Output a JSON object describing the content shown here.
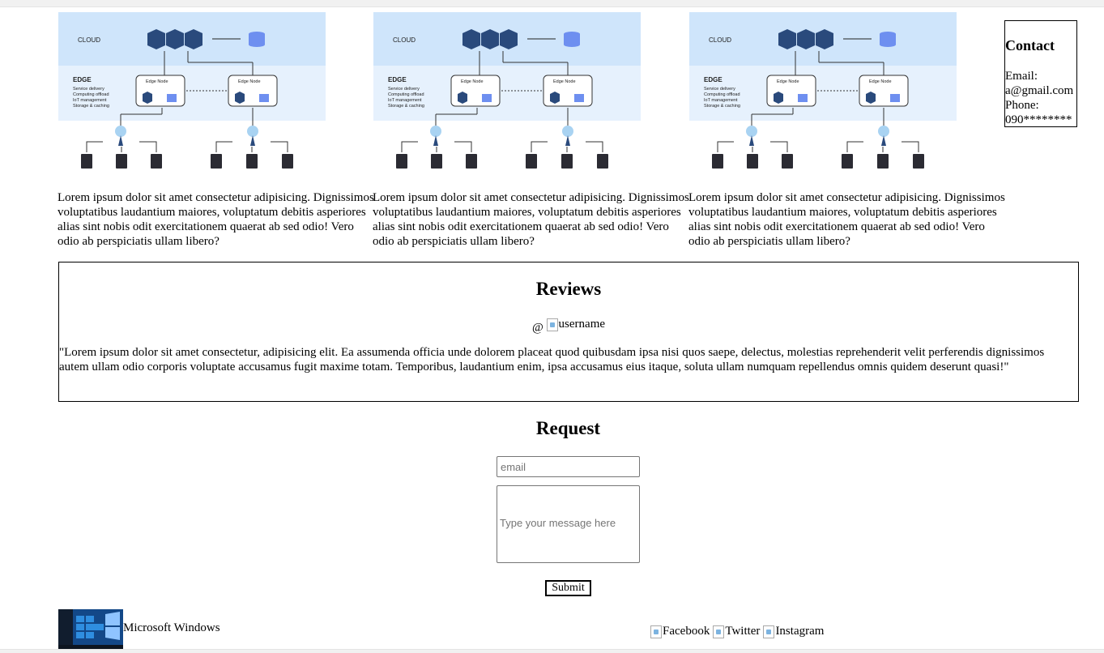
{
  "cards": [
    {
      "diagram": {
        "cloud_label": "CLOUD",
        "edge_label": "EDGE",
        "edge_items": [
          "Service delivery",
          "Computing offload",
          "IoT management",
          "Storage & caching"
        ],
        "node_label": "Edge Node"
      },
      "text": "Lorem ipsum dolor sit amet consectetur adipisicing. Dignissimos voluptatibus laudantium maiores, voluptatum debitis asperiores alias sint nobis odit exercitationem quaerat ab sed odio! Vero odio ab perspiciatis ullam libero?"
    },
    {
      "diagram": {
        "cloud_label": "CLOUD",
        "edge_label": "EDGE",
        "edge_items": [
          "Service delivery",
          "Computing offload",
          "IoT management",
          "Storage & caching"
        ],
        "node_label": "Edge Node"
      },
      "text": "Lorem ipsum dolor sit amet consectetur adipisicing. Dignissimos voluptatibus laudantium maiores, voluptatum debitis asperiores alias sint nobis odit exercitationem quaerat ab sed odio! Vero odio ab perspiciatis ullam libero?"
    },
    {
      "diagram": {
        "cloud_label": "CLOUD",
        "edge_label": "EDGE",
        "edge_items": [
          "Service delivery",
          "Computing offload",
          "IoT management",
          "Storage & caching"
        ],
        "node_label": "Edge Node"
      },
      "text": "Lorem ipsum dolor sit amet consectetur adipisicing. Dignissimos voluptatibus laudantium maiores, voluptatum debitis asperiores alias sint nobis odit exercitationem quaerat ab sed odio! Vero odio ab perspiciatis ullam libero?"
    }
  ],
  "contact": {
    "title": "Contact",
    "email_label": "Email:",
    "email_value": "a@gmail.com",
    "phone_label": "Phone:",
    "phone_value": "090********"
  },
  "reviews": {
    "title": "Reviews",
    "at_symbol": "@",
    "username_alt": "username",
    "quote": "\"Lorem ipsum dolor sit amet consectetur, adipisicing elit. Ea assumenda officia unde dolorem placeat quod quibusdam ipsa nisi quos saepe, delectus, molestias reprehenderit velit perferendis dignissimos autem ullam odio corporis voluptate accusamus fugit maxime totam. Temporibus, laudantium enim, ipsa accusamus eius itaque, soluta ullam numquam repellendus omnis quidem deserunt quasi!\""
  },
  "request": {
    "title": "Request",
    "email_placeholder": "email",
    "message_placeholder": "Type your message here",
    "submit_label": "Submit"
  },
  "footer": {
    "brand_text": "Microsoft Windows",
    "social": [
      "Facebook",
      "Twitter",
      "Instagram"
    ]
  },
  "colors": {
    "cloud_band": "#cfe5fb",
    "edge_band": "#e6f1fd",
    "server_blue": "#2a4a7c",
    "db_blue": "#6e8ff0"
  }
}
